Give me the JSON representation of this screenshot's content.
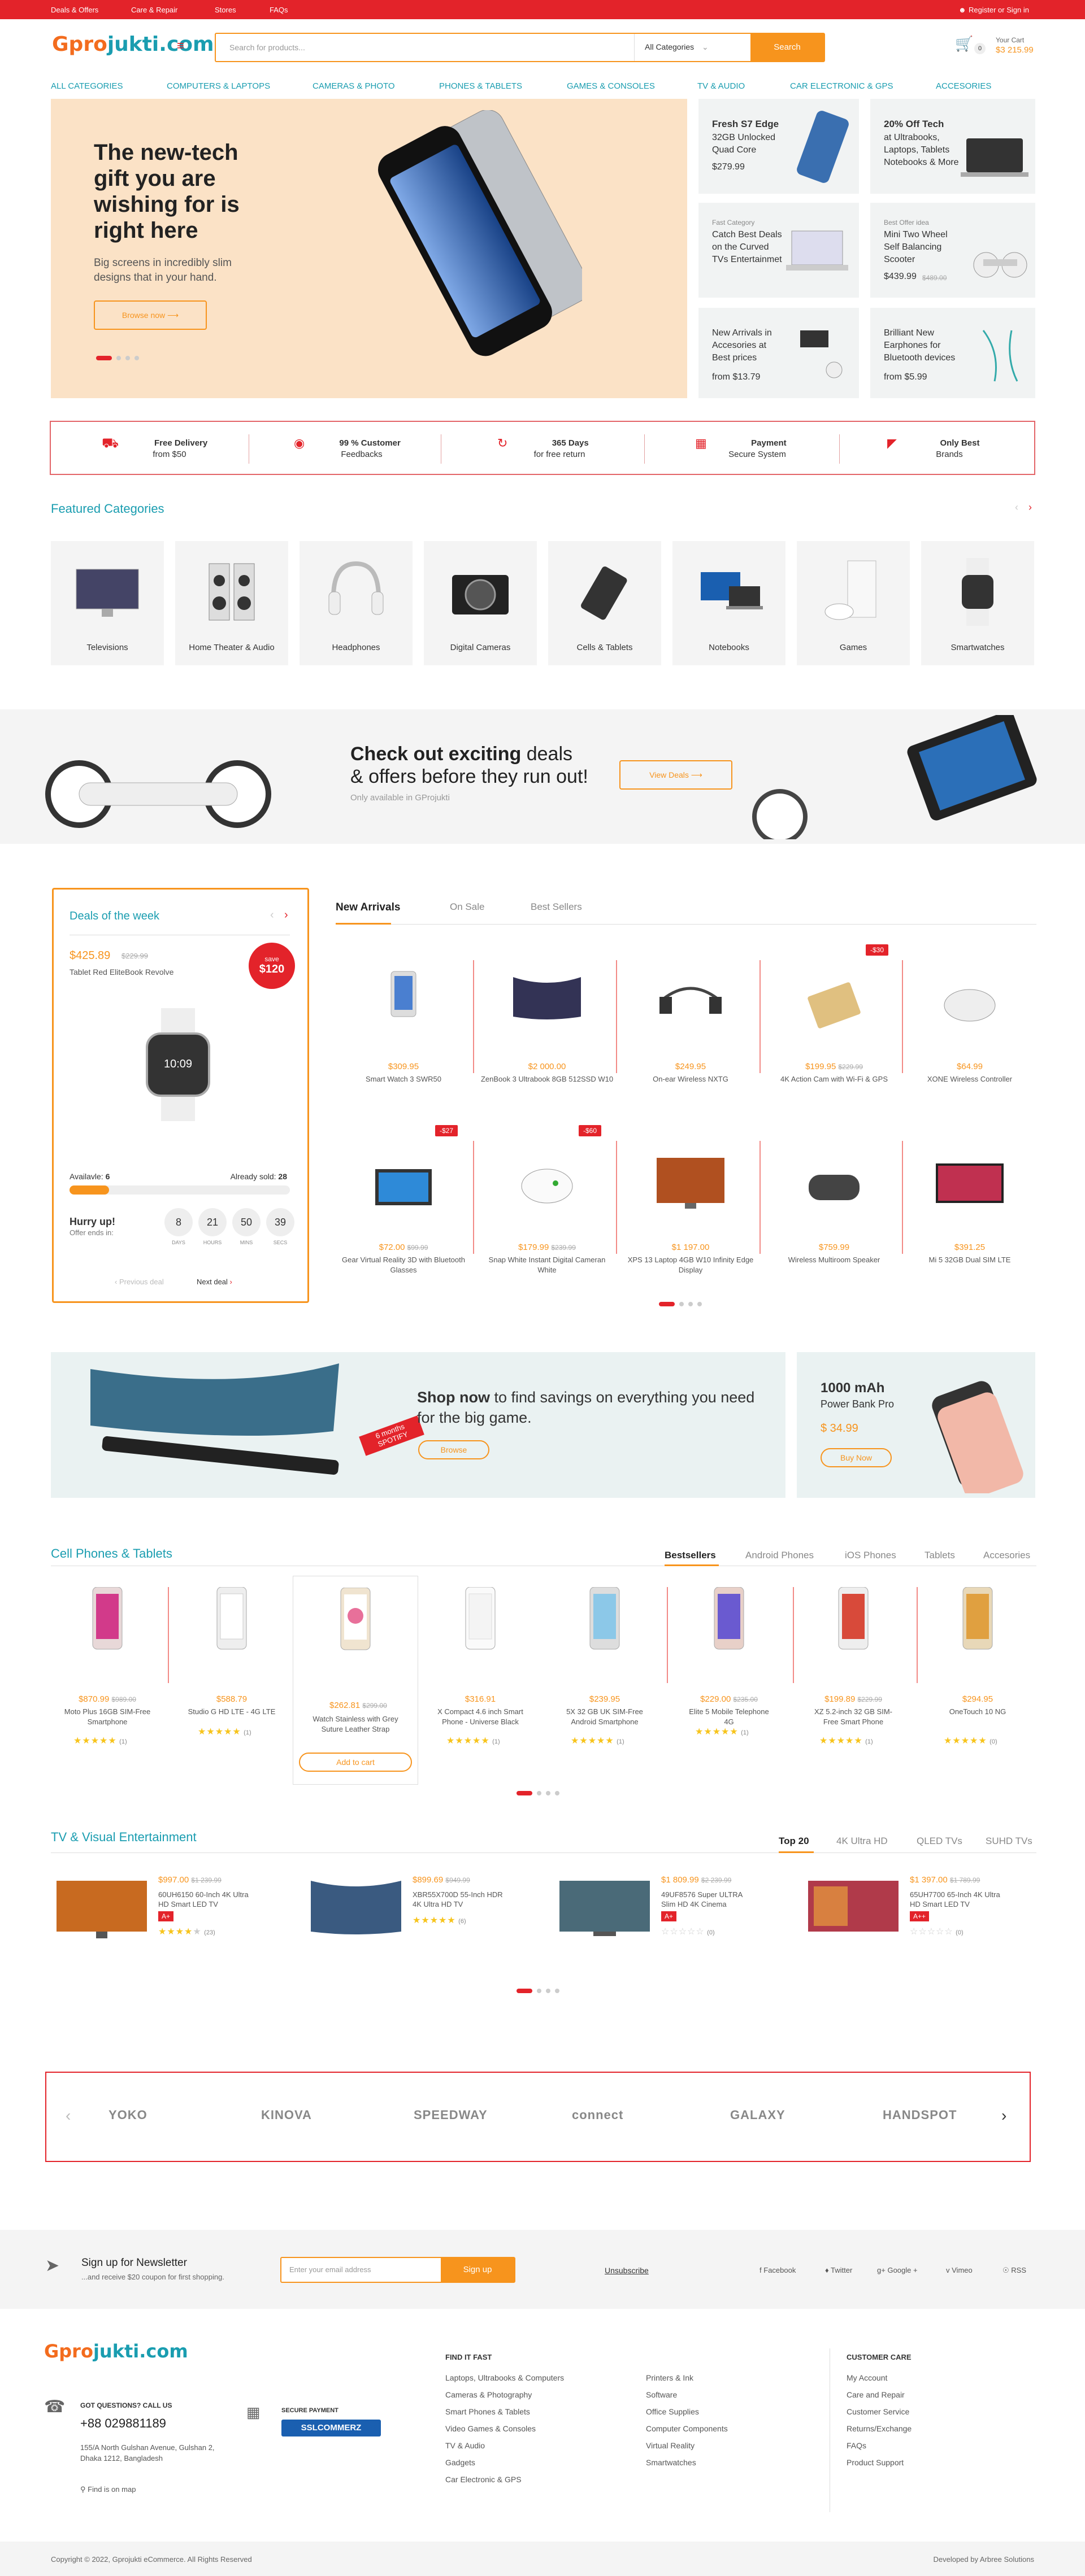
{
  "topbar": {
    "links": [
      "Deals & Offers",
      "Care & Repair",
      "Stores",
      "FAQs"
    ],
    "register": "Register or Sign in"
  },
  "header": {
    "logo_a": "Gpro",
    "logo_b": "jukti.com",
    "search_placeholder": "Search for products...",
    "category": "All Categories",
    "search_button": "Search",
    "cart_label": "Your Cart",
    "cart_total": "$3 215.99",
    "cart_count": "0"
  },
  "nav": [
    "ALL CATEGORIES",
    "COMPUTERS & LAPTOPS",
    "CAMERAS & PHOTO",
    "PHONES & TABLETS",
    "GAMES & CONSOLES",
    "TV & AUDIO",
    "CAR ELECTRONIC & GPS",
    "ACCESORIES"
  ],
  "hero": {
    "title": "The new-tech gift you are wishing for is right here",
    "subtitle": "Big screens in incredibly slim designs that in your hand.",
    "button": "Browse now"
  },
  "tiles": [
    {
      "t1": "Fresh S7 Edge",
      "t2": "32GB Unlocked Quad Core",
      "price": "$279.99"
    },
    {
      "t1": "20% Off Tech",
      "t2": "at Ultrabooks, Laptops, Tablets Notebooks & More"
    },
    {
      "small": "Fast Category",
      "t1": "Catch Best Deals on the Curved TVs Entertainmet"
    },
    {
      "small": "Best Offer idea",
      "t1": "Mini Two Wheel Self Balancing Scooter",
      "price": "$439.99",
      "old": "$489.00"
    },
    {
      "t1": "New Arrivals in Accesories at Best prices",
      "price": "from $13.79"
    },
    {
      "t1": "Brilliant New Earphones for Bluetooth devices",
      "price": "from $5.99"
    }
  ],
  "features": [
    {
      "a": "Free Delivery",
      "b": "from $50"
    },
    {
      "a": "99 % Customer",
      "b": "Feedbacks"
    },
    {
      "a": "365 Days",
      "b": "for free return"
    },
    {
      "a": "Payment",
      "b": "Secure System"
    },
    {
      "a": "Only Best",
      "b": "Brands"
    }
  ],
  "featured_title": "Featured Categories",
  "categories": [
    "Televisions",
    "Home Theater & Audio",
    "Headphones",
    "Digital Cameras",
    "Cells & Tablets",
    "Notebooks",
    "Games",
    "Smartwatches"
  ],
  "banner": {
    "t1": "Check out exciting",
    "t2": "deals",
    "t3": "& offers before they run out!",
    "sub": "Only available in GProjukti",
    "button": "View Deals"
  },
  "deal": {
    "title": "Deals of the week",
    "price": "$425.89",
    "old": "$229.99",
    "name": "Tablet Red EliteBook Revolve",
    "save_label": "save",
    "save": "$120",
    "available_label": "Availavle:",
    "available": "6",
    "sold_label": "Already sold:",
    "sold": "28",
    "progress": 0.18,
    "hurry": "Hurry up!",
    "offer": "Offer ends in:",
    "timer": [
      {
        "v": "8",
        "l": "DAYS"
      },
      {
        "v": "21",
        "l": "HOURS"
      },
      {
        "v": "50",
        "l": "MINS"
      },
      {
        "v": "39",
        "l": "SECS"
      }
    ],
    "prev": "Previous deal",
    "next": "Next deal"
  },
  "arrivals": {
    "tabs": [
      "New Arrivals",
      "On Sale",
      "Best Sellers"
    ],
    "products": [
      {
        "price": "$309.95",
        "name": "Smart Watch 3 SWR50"
      },
      {
        "price": "$2 000.00",
        "name": "ZenBook 3 Ultrabook 8GB 512SSD W10"
      },
      {
        "price": "$249.95",
        "name": "On-ear Wireless NXTG"
      },
      {
        "price": "$199.95",
        "old": "$229.99",
        "name": "4K Action Cam with Wi-Fi & GPS",
        "badge": "-$30"
      },
      {
        "price": "$64.99",
        "name": "XONE Wireless Controller"
      },
      {
        "price": "$72.00",
        "old": "$99.99",
        "name": "Gear Virtual Reality 3D with Bluetooth Glasses",
        "badge": "-$27"
      },
      {
        "price": "$179.99",
        "old": "$239.99",
        "name": "Snap White Instant Digital Cameran White",
        "badge": "-$60"
      },
      {
        "price": "$1 197.00",
        "name": "XPS 13 Laptop 4GB W10 Infinity Edge Display"
      },
      {
        "price": "$759.99",
        "name": "Wireless Multiroom Speaker"
      },
      {
        "price": "$391.25",
        "name": "Mi 5 32GB Dual SIM LTE"
      }
    ]
  },
  "promo1": {
    "t1": "Shop now",
    "t2": "to find savings on everything you need for the big game.",
    "button": "Browse",
    "ribbon": "6 months SPOTIFY"
  },
  "promo2": {
    "t1": "1000 mAh",
    "t2": "Power Bank Pro",
    "price": "$ 34.99",
    "button": "Buy Now"
  },
  "phones": {
    "title": "Cell Phones & Tablets",
    "tabs": [
      "Bestsellers",
      "Android Phones",
      "iOS Phones",
      "Tablets",
      "Accesories"
    ],
    "products": [
      {
        "price": "$870.99",
        "old": "$989.00",
        "name": "Moto Plus 16GB SIM-Free Smartphone",
        "reviews": "(1)"
      },
      {
        "price": "$588.79",
        "name": "Studio G HD LTE - 4G LTE",
        "reviews": "(1)"
      },
      {
        "price": "$262.81",
        "old": "$299.00",
        "name": "Watch Stainless with Grey Suture Leather Strap",
        "cart": "Add to cart"
      },
      {
        "price": "$316.91",
        "name": "X Compact 4.6 inch Smart Phone - Universe Black",
        "reviews": "(1)"
      },
      {
        "price": "$239.95",
        "name": "5X 32 GB UK SIM-Free Android Smartphone",
        "reviews": "(1)"
      },
      {
        "price": "$229.00",
        "old": "$235.00",
        "name": "Elite 5 Mobile Telephone 4G",
        "reviews": "(1)"
      },
      {
        "price": "$199.89",
        "old": "$229.99",
        "name": "XZ 5.2-inch 32 GB SIM-Free Smart Phone",
        "reviews": "(1)"
      },
      {
        "price": "$294.95",
        "name": "OneTouch 10 NG",
        "reviews": "(0)"
      }
    ]
  },
  "tv": {
    "title": "TV & Visual Entertainment",
    "tabs": [
      "Top 20",
      "4K Ultra HD",
      "QLED TVs",
      "SUHD TVs"
    ],
    "items": [
      {
        "price": "$997.00",
        "old": "$1 239.99",
        "name": "60UH6150 60-Inch 4K Ultra HD Smart LED TV",
        "reviews": "(23)",
        "rating": 4,
        "energy": "A+"
      },
      {
        "price": "$899.69",
        "old": "$949.99",
        "name": "XBR55X700D 55-Inch HDR 4K Ultra HD TV",
        "reviews": "(6)",
        "rating": 5
      },
      {
        "price": "$1 809.99",
        "old": "$2 239.99",
        "name": "49UF8576 Super ULTRA Slim HD 4K Cinema",
        "reviews": "(0)",
        "rating": 0,
        "energy": "A+"
      },
      {
        "price": "$1 397.00",
        "old": "$1 789.99",
        "name": "65UH7700 65-Inch 4K Ultra HD Smart LED TV",
        "reviews": "(0)",
        "rating": 0,
        "energy": "A++"
      }
    ]
  },
  "brands": [
    "YOKO",
    "KINOVA",
    "SPEEDWAY",
    "connect",
    "GALAXY",
    "HANDSPOT"
  ],
  "newsletter": {
    "title": "Sign up for Newsletter",
    "sub": "...and receive $20 coupon for first shopping.",
    "placeholder": "Enter your email address",
    "button": "Sign up",
    "unsub": "Unsubscribe",
    "social": [
      "Facebook",
      "Twitter",
      "Google +",
      "Vimeo",
      "RSS"
    ]
  },
  "footer": {
    "questions": "GOT QUESTIONS? CALL US",
    "phone": "+88 029881189",
    "address": "155/A North Gulshan Avenue, Gulshan 2, Dhaka 1212, Bangladesh",
    "map": "Find is on map",
    "secure": "SECURE PAYMENT",
    "ssl": "SSLCOMMERZ",
    "find_title": "FIND IT FAST",
    "col1": [
      "Laptops, Ultrabooks & Computers",
      "Cameras & Photography",
      "Smart Phones & Tablets",
      "Video Games & Consoles",
      "TV & Audio",
      "Gadgets",
      "Car Electronic & GPS"
    ],
    "col2": [
      "Printers & Ink",
      "Software",
      "Office Supplies",
      "Computer Components",
      "Virtual Reality",
      "Smartwatches"
    ],
    "care_title": "CUSTOMER CARE",
    "col3": [
      "My Account",
      "Care and Repair",
      "Customer Service",
      "Returns/Exchange",
      "FAQs",
      "Product Support"
    ]
  },
  "copyright": "Copyright © 2022, Gprojukti eCommerce. All Rights Reserved",
  "developed": "Developed by Arbree Solutions",
  "colors": {
    "red": "#e3232a",
    "orange": "#f7941d",
    "teal": "#1a9db0"
  }
}
